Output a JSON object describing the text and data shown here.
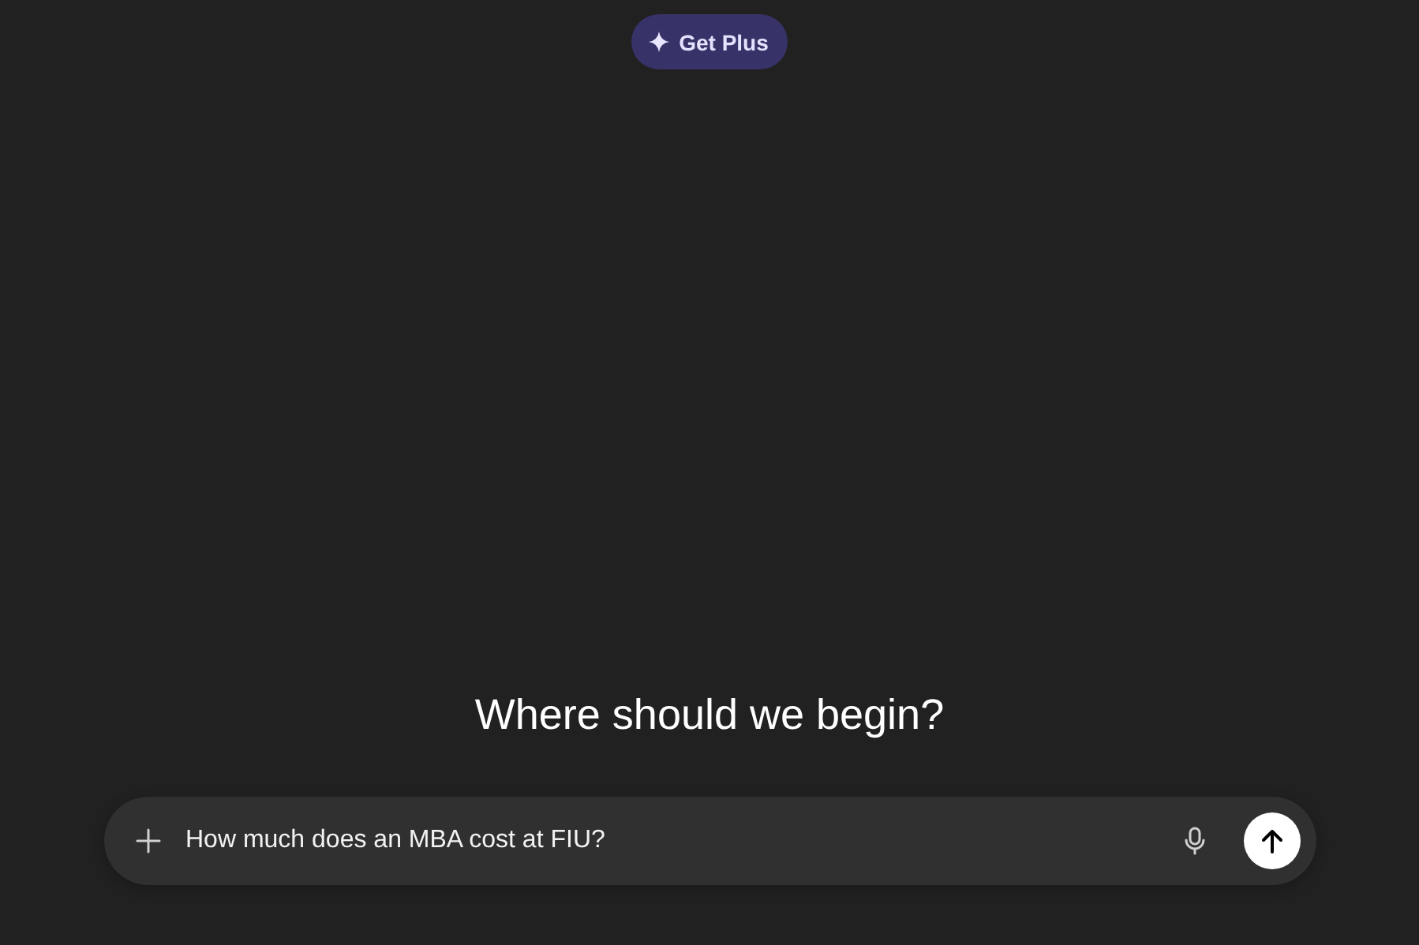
{
  "upgrade_button": {
    "label": "Get Plus"
  },
  "heading": "Where should we begin?",
  "composer": {
    "value": "How much does an MBA cost at FIU?"
  }
}
